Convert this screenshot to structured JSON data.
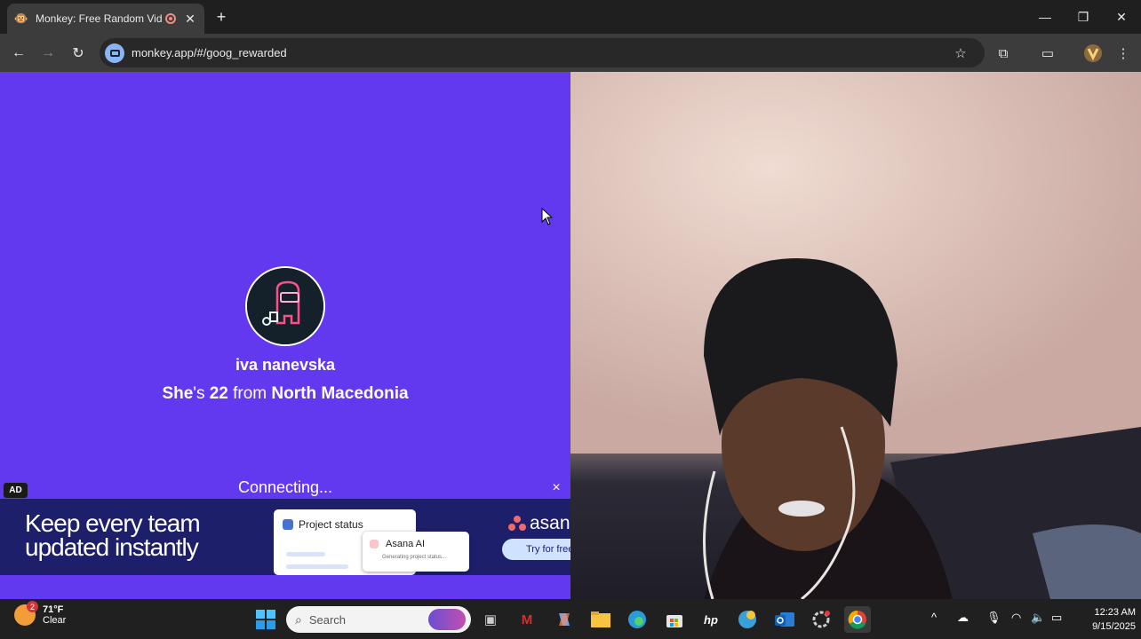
{
  "browser": {
    "tab_title": "Monkey: Free Random Vide",
    "tab_favicon": "monkey-favicon",
    "new_tab_symbol": "+",
    "url": "monkey.app/#/goog_rewarded"
  },
  "window_controls": {
    "minimize": "—",
    "maximize": "❐",
    "close": "✕"
  },
  "match": {
    "name": "iva nanevska",
    "pronoun": "She",
    "age_prefix": "'s ",
    "age": "22",
    "from_word": " from ",
    "country": "North Macedonia",
    "status": "Connecting..."
  },
  "ad": {
    "badge": "AD",
    "headline_line1": "Keep every team",
    "headline_line2": "updated instantly",
    "card_title": "Project status",
    "ai_label": "Asana AI",
    "ai_sub": "Generating project status...",
    "brand": "asana",
    "cta": "Try for free",
    "close_symbol": "×"
  },
  "taskbar": {
    "weather_temp": "71°F",
    "weather_desc": "Clear",
    "weather_badge": "2",
    "search_placeholder": "Search",
    "time": "12:23 AM",
    "date": "9/15/2025"
  },
  "colors": {
    "left_pane_bg": "#6339f0",
    "ad_bg": "#1e1f6b",
    "tabbar_bg": "#1f1f1f",
    "toolbar_bg": "#3c3c3c"
  }
}
